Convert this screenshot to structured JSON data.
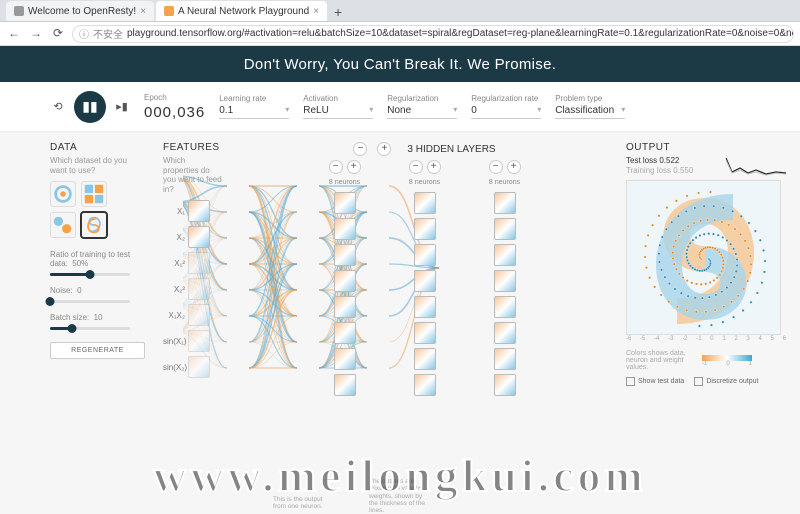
{
  "browser": {
    "tabs": [
      {
        "title": "Welcome to OpenResty!",
        "active": false
      },
      {
        "title": "A Neural Network Playground",
        "active": true
      }
    ],
    "security_label": "不安全",
    "url": "playground.tensorflow.org/#activation=relu&batchSize=10&dataset=spiral&regDataset=reg-plane&learningRate=0.1&regularizationRate=0&noise=0&networkShape=8,8,8&seed=0.80893&showTes"
  },
  "hero": "Don't Worry, You Can't Break It. We Promise.",
  "controls": {
    "epoch_label": "Epoch",
    "epoch_value": "000,036",
    "learning_rate_label": "Learning rate",
    "learning_rate_value": "0.1",
    "activation_label": "Activation",
    "activation_value": "ReLU",
    "regularization_label": "Regularization",
    "regularization_value": "None",
    "reg_rate_label": "Regularization rate",
    "reg_rate_value": "0",
    "problem_label": "Problem type",
    "problem_value": "Classification"
  },
  "data": {
    "head": "DATA",
    "sub": "Which dataset do you want to use?",
    "ratio_label": "Ratio of training to test data:",
    "ratio_value": "50%",
    "noise_label": "Noise:",
    "noise_value": "0",
    "batch_label": "Batch size:",
    "batch_value": "10",
    "regenerate": "REGENERATE"
  },
  "features": {
    "head": "FEATURES",
    "sub": "Which properties do you want to feed in?",
    "items": [
      "X₁",
      "X₂",
      "X₁²",
      "X₂²",
      "X₁X₂",
      "sin(X₁)",
      "sin(X₂)"
    ]
  },
  "network": {
    "head_count": "3",
    "head_label": "HIDDEN LAYERS",
    "neurons_label": "8 neurons",
    "anno1": "This is the output from one neuron.",
    "anno2": "The outputs are mixed with varying weights, shown by the thickness of the lines."
  },
  "output": {
    "head": "OUTPUT",
    "test_loss_label": "Test loss",
    "test_loss_value": "0.522",
    "train_loss_label": "Training loss",
    "train_loss_value": "0.550",
    "legend_text": "Colors shows data, neuron and weight values.",
    "legend_min": "-1",
    "legend_mid": "0",
    "legend_max": "1",
    "chk_test": "Show test data",
    "chk_disc": "Discretize output",
    "axis_ticks": [
      "-6",
      "-5",
      "-4",
      "-3",
      "-2",
      "-1",
      "0",
      "1",
      "2",
      "3",
      "4",
      "5",
      "6"
    ]
  },
  "watermark": "www.meilongkui.com"
}
